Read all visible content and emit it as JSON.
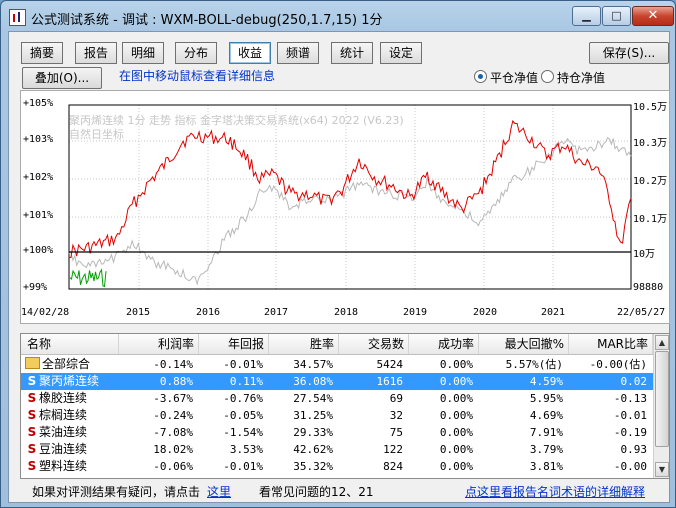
{
  "window": {
    "title": "公式测试系统 - 调试 : WXM-BOLL-debug(250,1.7,15) 1分"
  },
  "tabs": [
    "摘要",
    "报告",
    "明细",
    "分布",
    "收益",
    "频谱",
    "统计",
    "设定"
  ],
  "active_tab": "收益",
  "toolbar": {
    "save_label": "保存(S)...",
    "overlay_label": "叠加(O)...",
    "hint": "在图中移动鼠标查看详细信息",
    "radio_close": "平仓净值",
    "radio_hold": "持仓净值",
    "radio_selected": "平仓净值"
  },
  "chart": {
    "watermark_line1": "聚丙烯连续  1分  走势  指标  金字塔决策交易系统(x64) 2022 (V6.23)",
    "watermark_line2": "自然日坐标",
    "left_ticks": [
      "+105%",
      "+103%",
      "+102%",
      "+101%",
      "+100%",
      "+99%"
    ],
    "right_ticks": [
      "10.5万",
      "10.3万",
      "10.2万",
      "10.1万",
      "10万",
      "98880"
    ],
    "x_ticks": [
      "14/02/28",
      "2015",
      "2016",
      "2017",
      "2018",
      "2019",
      "2020",
      "2021",
      "22/05/27"
    ],
    "colors": {
      "close_equity": "#e00000",
      "hold_equity": "#b8b8b8",
      "below_baseline": "#00a000"
    }
  },
  "chart_data": {
    "type": "line",
    "xlabel": "",
    "ylabel": "",
    "x_range": [
      "2014-02-28",
      "2022-05-27"
    ],
    "ylim_percent": [
      99,
      105
    ],
    "series": [
      {
        "values_percent": [
          [
            "2014-02-28",
            100.0
          ],
          [
            "2014-06-01",
            100.1
          ],
          [
            "2014-09-01",
            100.25
          ],
          [
            "2014-11-15",
            100.4
          ],
          [
            "2015-02-01",
            101.3
          ],
          [
            "2015-05-01",
            101.9
          ],
          [
            "2015-08-01",
            102.4
          ],
          [
            "2015-11-01",
            103.0
          ],
          [
            "2016-01-15",
            103.3
          ],
          [
            "2016-04-01",
            103.2
          ],
          [
            "2016-07-01",
            103.1
          ],
          [
            "2016-10-01",
            102.6
          ],
          [
            "2016-12-15",
            102.0
          ],
          [
            "2017-03-01",
            102.1
          ],
          [
            "2017-06-01",
            101.6
          ],
          [
            "2017-09-01",
            101.6
          ],
          [
            "2017-12-01",
            101.4
          ],
          [
            "2018-03-01",
            101.7
          ],
          [
            "2018-06-01",
            102.5
          ],
          [
            "2018-09-01",
            102.0
          ],
          [
            "2018-12-01",
            101.8
          ],
          [
            "2019-03-01",
            101.5
          ],
          [
            "2019-06-01",
            102.1
          ],
          [
            "2019-09-01",
            101.6
          ],
          [
            "2019-12-01",
            101.2
          ],
          [
            "2020-03-01",
            101.6
          ],
          [
            "2020-06-01",
            102.4
          ],
          [
            "2020-09-01",
            103.9
          ],
          [
            "2020-12-01",
            103.2
          ],
          [
            "2021-03-01",
            102.6
          ],
          [
            "2021-06-01",
            102.9
          ],
          [
            "2021-09-01",
            102.4
          ],
          [
            "2021-12-01",
            102.3
          ],
          [
            "2022-02-01",
            101.5
          ],
          [
            "2022-04-01",
            100.1
          ],
          [
            "2022-05-27",
            101.5
          ]
        ]
      },
      {
        "values_percent": [
          [
            "2014-02-28",
            99.9
          ],
          [
            "2014-06-01",
            99.6
          ],
          [
            "2014-09-01",
            99.7
          ],
          [
            "2014-11-15",
            99.9
          ],
          [
            "2015-02-01",
            100.3
          ],
          [
            "2015-05-01",
            99.8
          ],
          [
            "2015-08-01",
            99.6
          ],
          [
            "2015-11-01",
            99.4
          ],
          [
            "2016-01-15",
            99.2
          ],
          [
            "2016-04-01",
            99.8
          ],
          [
            "2016-07-01",
            100.5
          ],
          [
            "2016-10-01",
            101.0
          ],
          [
            "2016-12-15",
            101.6
          ],
          [
            "2017-03-01",
            101.8
          ],
          [
            "2017-06-01",
            101.2
          ],
          [
            "2017-09-01",
            101.5
          ],
          [
            "2017-12-01",
            101.4
          ],
          [
            "2018-03-01",
            101.6
          ],
          [
            "2018-06-01",
            101.9
          ],
          [
            "2018-09-01",
            101.7
          ],
          [
            "2018-12-01",
            101.6
          ],
          [
            "2019-03-01",
            101.5
          ],
          [
            "2019-06-01",
            101.9
          ],
          [
            "2019-09-01",
            101.4
          ],
          [
            "2019-12-01",
            101.2
          ],
          [
            "2020-03-01",
            100.8
          ],
          [
            "2020-06-01",
            101.3
          ],
          [
            "2020-09-01",
            102.0
          ],
          [
            "2020-12-01",
            102.2
          ],
          [
            "2021-03-01",
            102.6
          ],
          [
            "2021-06-01",
            103.0
          ],
          [
            "2021-09-01",
            102.7
          ],
          [
            "2021-12-01",
            102.9
          ],
          [
            "2022-02-01",
            103.1
          ],
          [
            "2022-04-01",
            102.8
          ],
          [
            "2022-05-27",
            102.6
          ]
        ]
      }
    ],
    "baseline_percent": 100
  },
  "table": {
    "headers": [
      "名称",
      "利润率",
      "年回报",
      "胜率",
      "交易数",
      "成功率",
      "最大回撤%",
      "MAR比率"
    ],
    "rows": [
      {
        "name": "全部综合",
        "icon": "folder",
        "profit": "-0.14%",
        "annual": "-0.01%",
        "win": "34.57%",
        "trades": "5424",
        "success": "0.00%",
        "maxdd": "5.57%(估)",
        "mar": "-0.00(估)",
        "selected": false
      },
      {
        "name": "聚丙烯连续",
        "icon": "S",
        "profit": "0.88%",
        "annual": "0.11%",
        "win": "36.08%",
        "trades": "1616",
        "success": "0.00%",
        "maxdd": "4.59%",
        "mar": "0.02",
        "selected": true
      },
      {
        "name": "橡胶连续",
        "icon": "S",
        "profit": "-3.67%",
        "annual": "-0.76%",
        "win": "27.54%",
        "trades": "69",
        "success": "0.00%",
        "maxdd": "5.95%",
        "mar": "-0.13",
        "selected": false
      },
      {
        "name": "棕榈连续",
        "icon": "S",
        "profit": "-0.24%",
        "annual": "-0.05%",
        "win": "31.25%",
        "trades": "32",
        "success": "0.00%",
        "maxdd": "4.69%",
        "mar": "-0.01",
        "selected": false
      },
      {
        "name": "菜油连续",
        "icon": "S",
        "profit": "-7.08%",
        "annual": "-1.54%",
        "win": "29.33%",
        "trades": "75",
        "success": "0.00%",
        "maxdd": "7.91%",
        "mar": "-0.19",
        "selected": false
      },
      {
        "name": "豆油连续",
        "icon": "S",
        "profit": "18.02%",
        "annual": "3.53%",
        "win": "42.62%",
        "trades": "122",
        "success": "0.00%",
        "maxdd": "3.79%",
        "mar": "0.93",
        "selected": false
      },
      {
        "name": "塑料连续",
        "icon": "S",
        "profit": "-0.06%",
        "annual": "-0.01%",
        "win": "35.32%",
        "trades": "824",
        "success": "0.00%",
        "maxdd": "3.81%",
        "mar": "-0.00",
        "selected": false
      }
    ]
  },
  "footer": {
    "question": "如果对评测结果有疑问，请点击",
    "here_link": "这里",
    "faq": "看常见问题的12、21",
    "terms_link": "点这里看报告名词术语的详细解释"
  }
}
